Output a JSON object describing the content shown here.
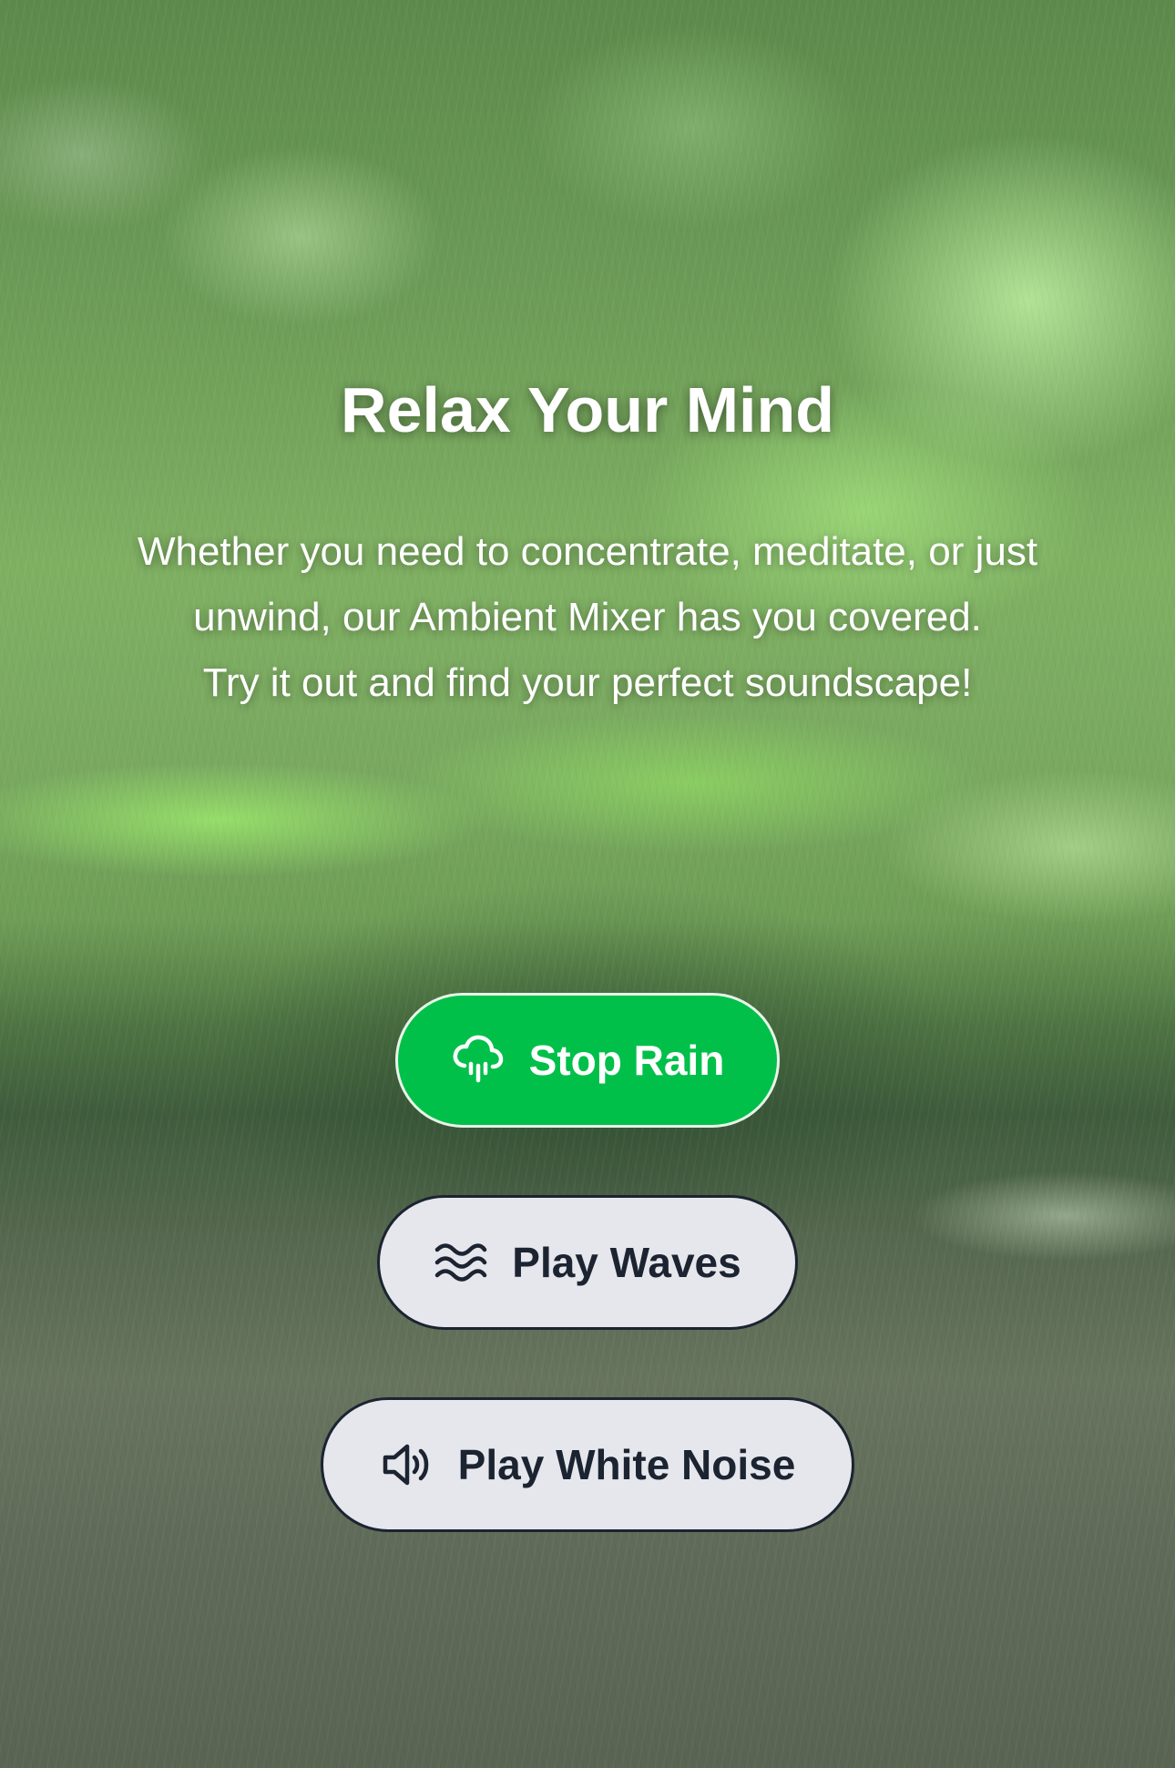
{
  "hero": {
    "title": "Relax Your Mind",
    "description_lines": [
      "Whether you need to concentrate, meditate, or just",
      "unwind, our Ambient Mixer has you covered.",
      "Try it out and find your perfect soundscape!"
    ]
  },
  "controls": {
    "rain": {
      "label": "Stop Rain",
      "icon": "cloud-rain-icon",
      "state": "playing"
    },
    "waves": {
      "label": "Play Waves",
      "icon": "waves-icon",
      "state": "stopped"
    },
    "white_noise": {
      "label": "Play White Noise",
      "icon": "speaker-volume-icon",
      "state": "stopped"
    }
  },
  "colors": {
    "active_button": "#00c04a",
    "inactive_button": "#e5e7ec",
    "inactive_text": "#1c2331",
    "active_text": "#ffffff"
  }
}
